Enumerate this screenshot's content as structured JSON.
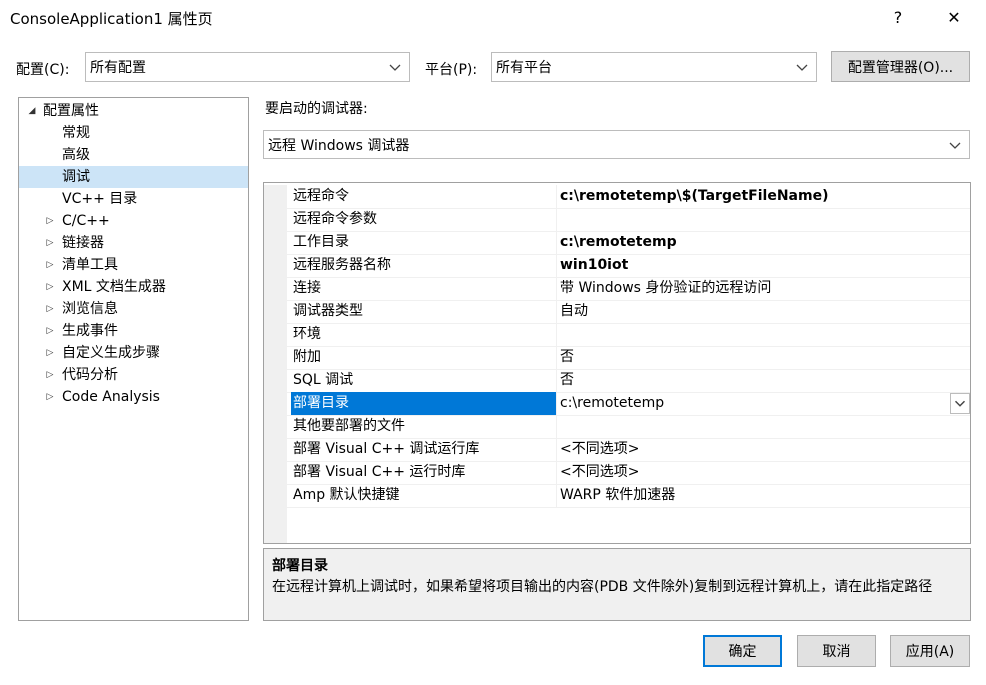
{
  "window": {
    "title": "ConsoleApplication1 属性页",
    "help_button": "?",
    "close_button": "✕"
  },
  "config_bar": {
    "config_label": "配置(C):",
    "config_value": "所有配置",
    "platform_label": "平台(P):",
    "platform_value": "所有平台",
    "manager_button": "配置管理器(O)..."
  },
  "tree": {
    "root_label": "配置属性",
    "items": [
      {
        "label": "常规",
        "expandable": false,
        "selected": false
      },
      {
        "label": "高级",
        "expandable": false,
        "selected": false
      },
      {
        "label": "调试",
        "expandable": false,
        "selected": true
      },
      {
        "label": "VC++ 目录",
        "expandable": false,
        "selected": false
      },
      {
        "label": "C/C++",
        "expandable": true,
        "selected": false
      },
      {
        "label": "链接器",
        "expandable": true,
        "selected": false
      },
      {
        "label": "清单工具",
        "expandable": true,
        "selected": false
      },
      {
        "label": "XML 文档生成器",
        "expandable": true,
        "selected": false
      },
      {
        "label": "浏览信息",
        "expandable": true,
        "selected": false
      },
      {
        "label": "生成事件",
        "expandable": true,
        "selected": false
      },
      {
        "label": "自定义生成步骤",
        "expandable": true,
        "selected": false
      },
      {
        "label": "代码分析",
        "expandable": true,
        "selected": false
      },
      {
        "label": "Code Analysis",
        "expandable": true,
        "selected": false
      }
    ]
  },
  "debugger": {
    "label": "要启动的调试器:",
    "value": "远程 Windows 调试器"
  },
  "properties": [
    {
      "name": "远程命令",
      "value": "c:\\remotetemp\\$(TargetFileName)",
      "bold": true
    },
    {
      "name": "远程命令参数",
      "value": "",
      "bold": false
    },
    {
      "name": "工作目录",
      "value": "c:\\remotetemp",
      "bold": true
    },
    {
      "name": "远程服务器名称",
      "value": "win10iot",
      "bold": true
    },
    {
      "name": "连接",
      "value": "带 Windows 身份验证的远程访问",
      "bold": false
    },
    {
      "name": "调试器类型",
      "value": "自动",
      "bold": false
    },
    {
      "name": "环境",
      "value": "",
      "bold": false
    },
    {
      "name": "附加",
      "value": "否",
      "bold": false
    },
    {
      "name": "SQL 调试",
      "value": "否",
      "bold": false
    },
    {
      "name": "部署目录",
      "value": "c:\\remotetemp",
      "bold": false,
      "selected": true
    },
    {
      "name": "其他要部署的文件",
      "value": "",
      "bold": false
    },
    {
      "name": "部署 Visual C++ 调试运行库",
      "value": "<不同选项>",
      "bold": false
    },
    {
      "name": "部署 Visual C++ 运行时库",
      "value": "<不同选项>",
      "bold": false
    },
    {
      "name": "Amp 默认快捷键",
      "value": "WARP 软件加速器",
      "bold": false
    }
  ],
  "description": {
    "title": "部署目录",
    "text": "在远程计算机上调试时，如果希望将项目输出的内容(PDB 文件除外)复制到远程计算机上，请在此指定路径"
  },
  "buttons": {
    "ok": "确定",
    "cancel": "取消",
    "apply": "应用(A)"
  },
  "colors": {
    "selection": "#0078d7",
    "tree_selection": "#cce4f7",
    "gutter": "#f0f0f0"
  }
}
